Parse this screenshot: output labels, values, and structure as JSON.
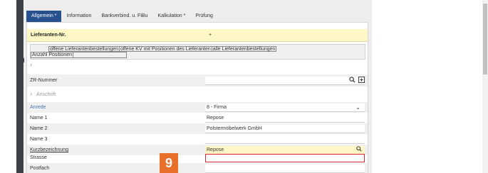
{
  "tabs": [
    {
      "label": "Allgemein *",
      "active": true
    },
    {
      "label": "Information",
      "active": false
    },
    {
      "label": "Bankverbind. u. FiBu",
      "active": false
    },
    {
      "label": "Kalkulation *",
      "active": false
    },
    {
      "label": "Prüfung",
      "active": false
    }
  ],
  "header": {
    "label": "Lieferanten-Nr.",
    "value": "+"
  },
  "table": {
    "columns": [
      "offene Lieferantenbestellungen",
      "offene KV mit Positionen des Lieferanten",
      "alle Lieferantenbestellungen"
    ],
    "second_row": "Anzahl Positionen"
  },
  "zr": {
    "label": "ZR-Nummer",
    "value": ""
  },
  "section": {
    "label": "Anschrift"
  },
  "fields": {
    "anrede": {
      "label": "Anrede",
      "value": "8 - Firma"
    },
    "name1": {
      "label": "Name 1",
      "value": "Repose"
    },
    "name2": {
      "label": "Name 2",
      "value": "Polstermöbelwerk GmbH"
    },
    "name3": {
      "label": "Name 3",
      "value": ""
    },
    "kurz": {
      "label": "Kurzbezeichnung",
      "value": "Repose"
    },
    "strasse": {
      "label": "Strasse",
      "value": ""
    },
    "postfach": {
      "label": "Postfach",
      "value": ""
    }
  },
  "badge": "9",
  "colors": {
    "accent": "#27508f",
    "required": "#fff8c6",
    "error": "#d9232e",
    "badge": "#e8702a"
  }
}
